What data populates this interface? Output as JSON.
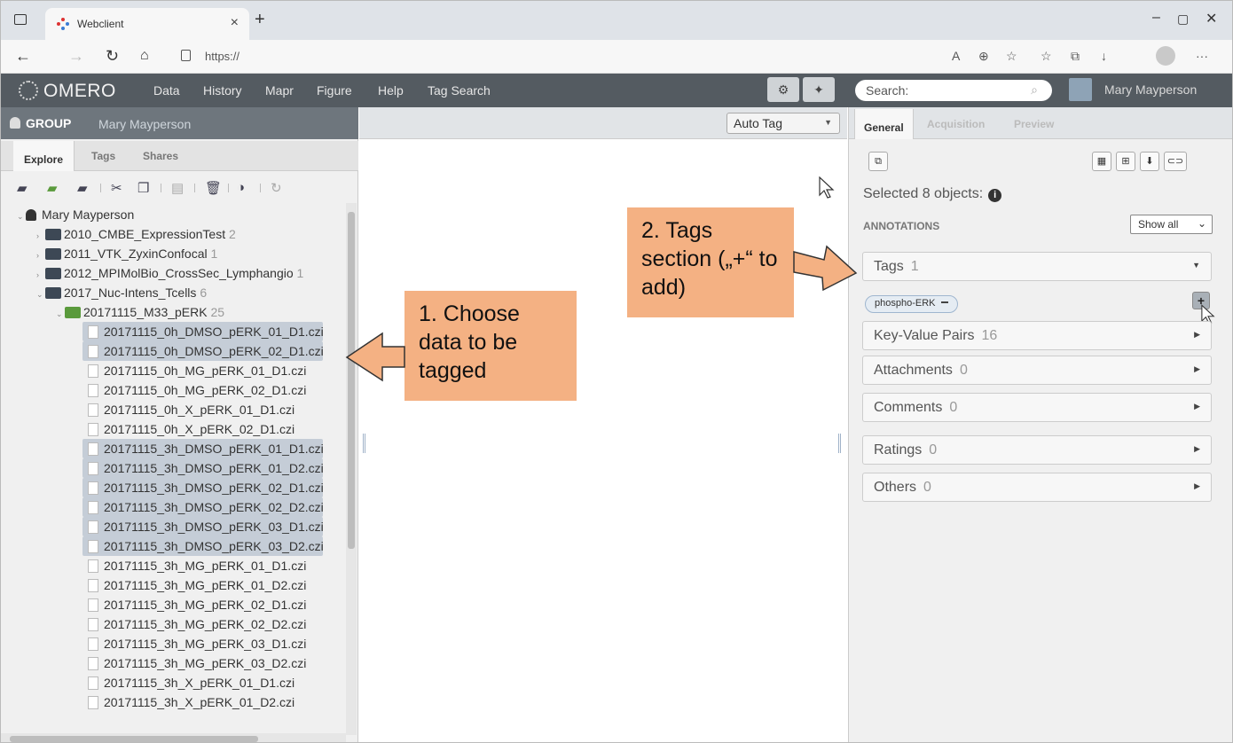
{
  "browser": {
    "tab_title": "Webclient",
    "url": "https://"
  },
  "omero": {
    "logo": "OMERO",
    "menu": [
      "Data",
      "History",
      "Mapr",
      "Figure",
      "Help",
      "Tag Search"
    ],
    "search_placeholder": "Search:",
    "user": "Mary Mayperson"
  },
  "left": {
    "group_label": "GROUP",
    "group_owner": "Mary Mayperson",
    "tabs": [
      "Explore",
      "Tags",
      "Shares"
    ],
    "tree_root": "Mary Mayperson",
    "projects": [
      {
        "name": "2010_CMBE_ExpressionTest",
        "count": "2"
      },
      {
        "name": "2011_VTK_ZyxinConfocal",
        "count": "1"
      },
      {
        "name": "2012_MPIMolBio_CrossSec_Lymphangio",
        "count": "1"
      },
      {
        "name": "2017_Nuc-Intens_Tcells",
        "count": "6"
      }
    ],
    "dataset": {
      "name": "20171115_M33_pERK",
      "count": "25"
    },
    "files": [
      {
        "name": "20171115_0h_DMSO_pERK_01_D1.czi",
        "selected": true
      },
      {
        "name": "20171115_0h_DMSO_pERK_02_D1.czi",
        "selected": true
      },
      {
        "name": "20171115_0h_MG_pERK_01_D1.czi",
        "selected": false
      },
      {
        "name": "20171115_0h_MG_pERK_02_D1.czi",
        "selected": false
      },
      {
        "name": "20171115_0h_X_pERK_01_D1.czi",
        "selected": false
      },
      {
        "name": "20171115_0h_X_pERK_02_D1.czi",
        "selected": false
      },
      {
        "name": "20171115_3h_DMSO_pERK_01_D1.czi",
        "selected": true
      },
      {
        "name": "20171115_3h_DMSO_pERK_01_D2.czi",
        "selected": true
      },
      {
        "name": "20171115_3h_DMSO_pERK_02_D1.czi",
        "selected": true
      },
      {
        "name": "20171115_3h_DMSO_pERK_02_D2.czi",
        "selected": true
      },
      {
        "name": "20171115_3h_DMSO_pERK_03_D1.czi",
        "selected": true
      },
      {
        "name": "20171115_3h_DMSO_pERK_03_D2.czi",
        "selected": true
      },
      {
        "name": "20171115_3h_MG_pERK_01_D1.czi",
        "selected": false
      },
      {
        "name": "20171115_3h_MG_pERK_01_D2.czi",
        "selected": false
      },
      {
        "name": "20171115_3h_MG_pERK_02_D1.czi",
        "selected": false
      },
      {
        "name": "20171115_3h_MG_pERK_02_D2.czi",
        "selected": false
      },
      {
        "name": "20171115_3h_MG_pERK_03_D1.czi",
        "selected": false
      },
      {
        "name": "20171115_3h_MG_pERK_03_D2.czi",
        "selected": false
      },
      {
        "name": "20171115_3h_X_pERK_01_D1.czi",
        "selected": false
      },
      {
        "name": "20171115_3h_X_pERK_01_D2.czi",
        "selected": false
      }
    ]
  },
  "center": {
    "auto_tag": "Auto Tag"
  },
  "right": {
    "tabs": [
      "General",
      "Acquisition",
      "Preview"
    ],
    "selected_text": "Selected 8 objects:",
    "annotations_label": "ANNOTATIONS",
    "show_all": "Show all",
    "sections": [
      {
        "label": "Tags",
        "count": "1"
      },
      {
        "label": "Key-Value Pairs",
        "count": "16"
      },
      {
        "label": "Attachments",
        "count": "0"
      },
      {
        "label": "Comments",
        "count": "0"
      },
      {
        "label": "Ratings",
        "count": "0"
      },
      {
        "label": "Others",
        "count": "0"
      }
    ],
    "tag_pill": "phospho-ERK"
  },
  "callouts": {
    "one": "1. Choose data to be tagged",
    "two": "2. Tags section („+“ to add)"
  },
  "colors": {
    "callout": "#f4b183",
    "omero_header": "#545b61",
    "selection": "#c5cdd7"
  }
}
